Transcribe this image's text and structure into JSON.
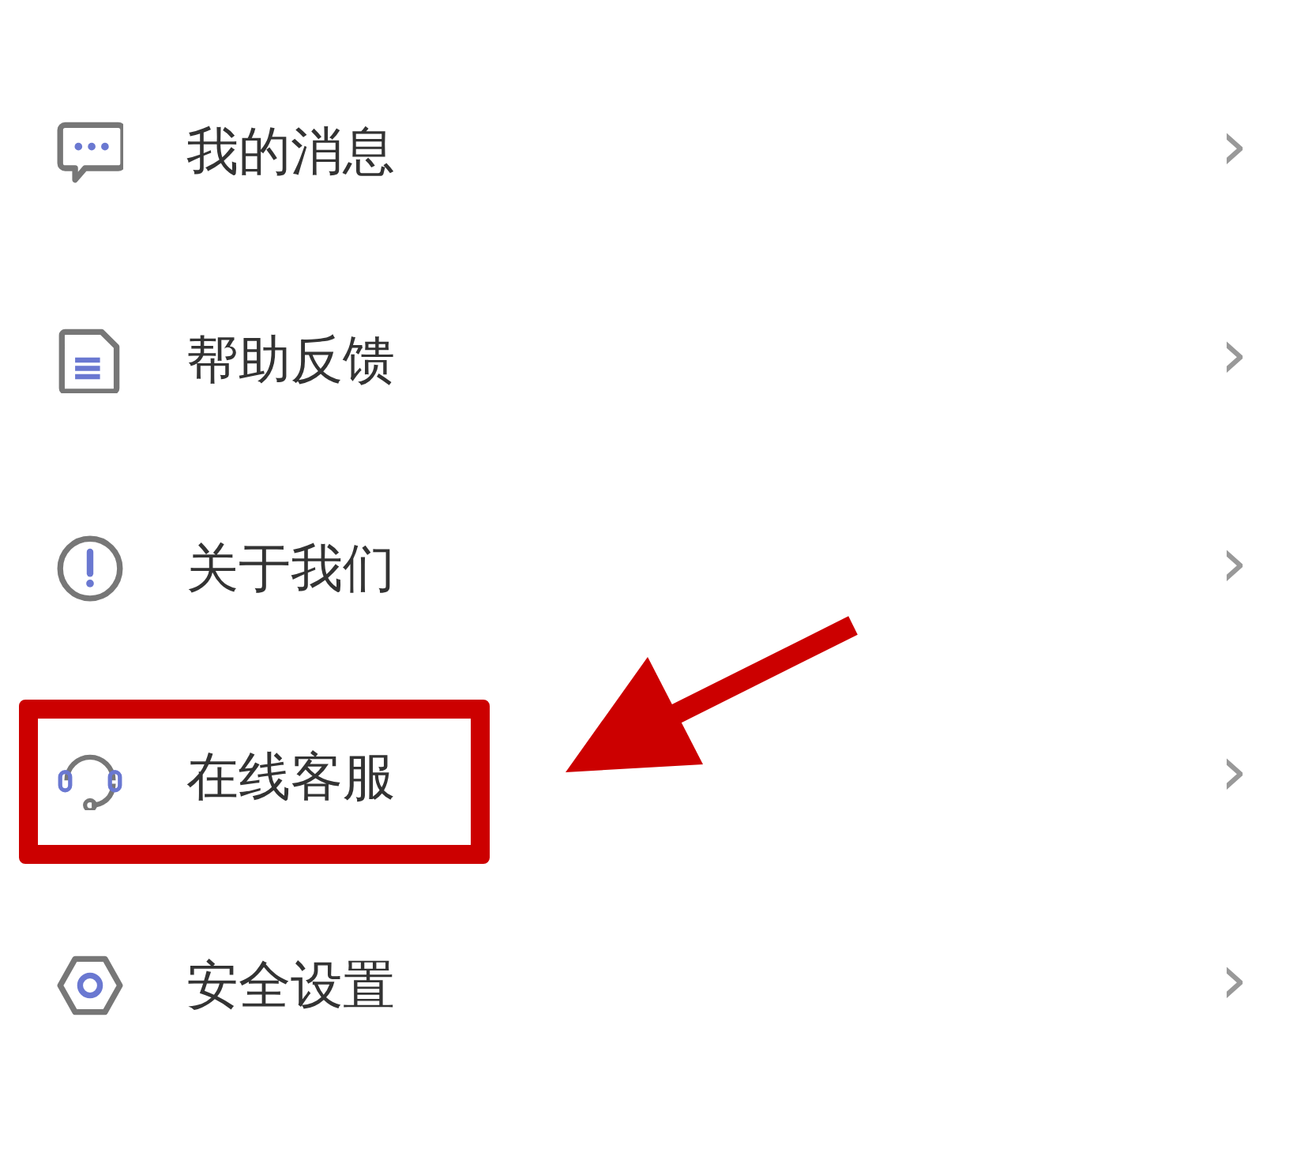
{
  "menu": [
    {
      "label": "我的消息",
      "chevron": "›",
      "highlighted": false
    },
    {
      "label": "帮助反馈",
      "chevron": "›",
      "highlighted": false
    },
    {
      "label": "关于我们",
      "chevron": "›",
      "highlighted": false
    },
    {
      "label": "在线客服",
      "chevron": "›",
      "highlighted": true
    },
    {
      "label": "安全设置",
      "chevron": "›",
      "highlighted": false
    }
  ]
}
